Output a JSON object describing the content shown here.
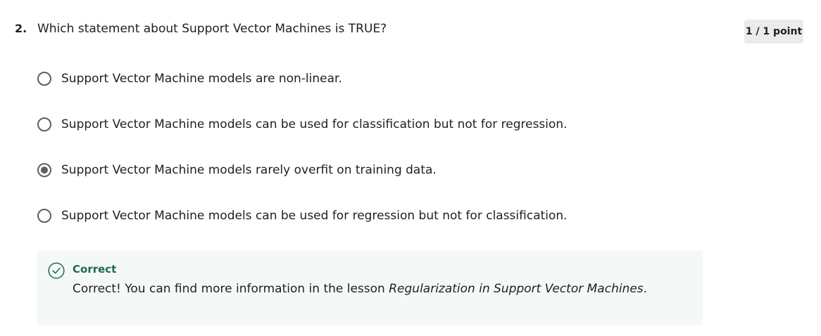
{
  "question": {
    "number": "2.",
    "text": "Which statement about Support Vector Machines is TRUE?",
    "score": "1 / 1 point"
  },
  "options": [
    {
      "label": "Support Vector Machine models are non-linear.",
      "selected": false
    },
    {
      "label": "Support Vector Machine models can be used for classification but not for regression.",
      "selected": false
    },
    {
      "label": "Support Vector Machine models rarely overfit on training data.",
      "selected": true
    },
    {
      "label": "Support Vector Machine models can be used for regression but not for classification.",
      "selected": false
    }
  ],
  "feedback": {
    "status": "Correct",
    "message_prefix": "Correct! You can find more information in the lesson ",
    "lesson_title": "Regularization in Support Vector Machines",
    "message_suffix": ".",
    "icon": "check-circle-icon",
    "accent_color": "#1d6b47"
  },
  "colors": {
    "radio": "#5f5f5f",
    "feedback_background": "#f4f8f7",
    "badge_background": "#ebebeb"
  }
}
